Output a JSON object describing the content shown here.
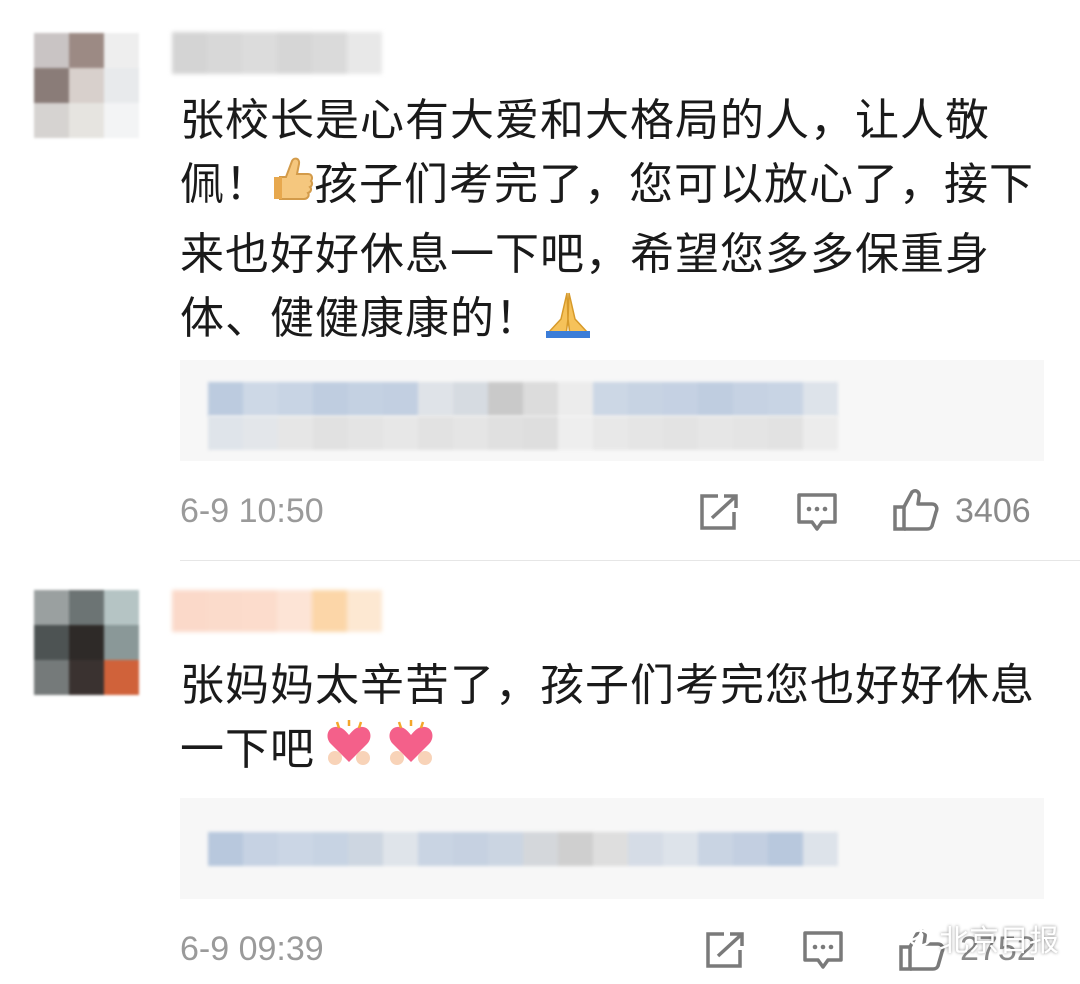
{
  "comments": [
    {
      "text": "张校长是心有大爱和大格局的人，让人敬佩！👍孩子们考完了，您可以放心了，接下来也好好休息一下吧，希望您多多保重身体、健健康康的！🙏",
      "text_parts": {
        "a": "张校长是心有大爱和大格局的人，让人敬佩！",
        "b": "孩子们考完了，您可以放心了，接下来也好好休息一下吧，希望您多多保重身体、健健康康的！"
      },
      "timestamp": "6-9 10:50",
      "like_count": "3406",
      "icons": [
        "share-icon",
        "comment-icon",
        "thumbs-up-icon"
      ]
    },
    {
      "text_parts": {
        "a": "张妈妈太辛苦了，孩子们考完您也好好休息一下吧"
      },
      "timestamp": "6-9 09:39",
      "like_count": "2752",
      "icons": [
        "share-icon",
        "comment-icon",
        "thumbs-up-icon"
      ]
    }
  ],
  "watermark": {
    "text": "北京日报"
  },
  "colors": {
    "text": "#1a1a1a",
    "meta": "#9a9a9a",
    "reply_bg": "#f7f7f7"
  }
}
